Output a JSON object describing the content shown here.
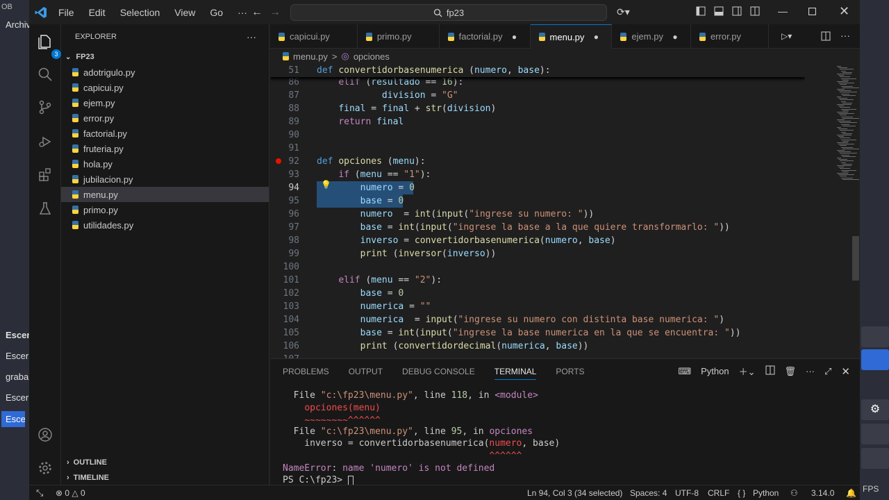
{
  "background_app": {
    "title_fragment": "OB",
    "menu_fragment": "Archiv",
    "left_texts": [
      "Escen",
      "Escer",
      "graba",
      "Escer",
      "Escer"
    ],
    "fps": "FPS"
  },
  "titlebar": {
    "menus": [
      "File",
      "Edit",
      "Selection",
      "View",
      "Go",
      "···"
    ],
    "search_text": "fp23"
  },
  "activity": {
    "badge": "3"
  },
  "explorer": {
    "header": "EXPLORER",
    "more": "···",
    "folder": "FP23",
    "files": [
      "adotrigulo.py",
      "capicui.py",
      "ejem.py",
      "error.py",
      "factorial.py",
      "fruteria.py",
      "hola.py",
      "jubilacion.py",
      "menu.py",
      "primo.py",
      "utilidades.py"
    ],
    "selected": "menu.py",
    "outline": "OUTLINE",
    "timeline": "TIMELINE"
  },
  "tabs": [
    {
      "label": "capicui.py",
      "state": "",
      "active": false
    },
    {
      "label": "primo.py",
      "state": "",
      "active": false
    },
    {
      "label": "factorial.py",
      "state": "●",
      "active": false
    },
    {
      "label": "menu.py",
      "state": "●",
      "active": true
    },
    {
      "label": "ejem.py",
      "state": "●",
      "active": false
    },
    {
      "label": "error.py",
      "state": "",
      "active": false
    }
  ],
  "breadcrumb": {
    "file": "menu.py",
    "separator": ">",
    "symbol": "opciones"
  },
  "editor": {
    "sticky_line": {
      "n": "51",
      "tokens": [
        [
          "kw",
          "def "
        ],
        [
          "fn",
          "convertidorbasenumerica"
        ],
        [
          "op",
          " ("
        ],
        [
          "var",
          "numero"
        ],
        [
          "op",
          ", "
        ],
        [
          "var",
          "base"
        ],
        [
          "op",
          "):"
        ]
      ]
    },
    "lines": [
      {
        "n": "86",
        "tokens": [
          [
            "op",
            "    "
          ],
          [
            "ctl",
            "elif"
          ],
          [
            "op",
            " ("
          ],
          [
            "var",
            "resultado"
          ],
          [
            "op",
            " == "
          ],
          [
            "num",
            "16"
          ],
          [
            "op",
            "):"
          ]
        ]
      },
      {
        "n": "87",
        "tokens": [
          [
            "op",
            "            "
          ],
          [
            "var",
            "division"
          ],
          [
            "op",
            " = "
          ],
          [
            "str",
            "\"G\""
          ]
        ]
      },
      {
        "n": "88",
        "tokens": [
          [
            "op",
            "    "
          ],
          [
            "var",
            "final"
          ],
          [
            "op",
            " = "
          ],
          [
            "var",
            "final"
          ],
          [
            "op",
            " + "
          ],
          [
            "fn",
            "str"
          ],
          [
            "op",
            "("
          ],
          [
            "var",
            "division"
          ],
          [
            "op",
            ")"
          ]
        ]
      },
      {
        "n": "89",
        "tokens": [
          [
            "op",
            "    "
          ],
          [
            "ctl",
            "return"
          ],
          [
            "op",
            " "
          ],
          [
            "var",
            "final"
          ]
        ]
      },
      {
        "n": "90",
        "tokens": []
      },
      {
        "n": "91",
        "tokens": []
      },
      {
        "n": "92",
        "tokens": [
          [
            "kw",
            "def "
          ],
          [
            "fn",
            "opciones"
          ],
          [
            "op",
            " ("
          ],
          [
            "var",
            "menu"
          ],
          [
            "op",
            "):"
          ]
        ]
      },
      {
        "n": "93",
        "tokens": [
          [
            "op",
            "    "
          ],
          [
            "ctl",
            "if"
          ],
          [
            "op",
            " ("
          ],
          [
            "var",
            "menu"
          ],
          [
            "op",
            " == "
          ],
          [
            "str",
            "\"1\""
          ],
          [
            "op",
            "):"
          ]
        ]
      },
      {
        "n": "94",
        "tokens": [
          [
            "op",
            "        "
          ],
          [
            "var",
            "numero"
          ],
          [
            "op",
            " = "
          ],
          [
            "num",
            "0"
          ]
        ]
      },
      {
        "n": "95",
        "tokens": [
          [
            "op",
            "        "
          ],
          [
            "var",
            "base"
          ],
          [
            "op",
            " = "
          ],
          [
            "num",
            "0"
          ]
        ]
      },
      {
        "n": "96",
        "tokens": [
          [
            "op",
            "        "
          ],
          [
            "var",
            "numero"
          ],
          [
            "op",
            "  = "
          ],
          [
            "fn",
            "int"
          ],
          [
            "op",
            "("
          ],
          [
            "fn",
            "input"
          ],
          [
            "op",
            "("
          ],
          [
            "str",
            "\"ingrese su numero: \""
          ],
          [
            "op",
            "))"
          ]
        ]
      },
      {
        "n": "97",
        "tokens": [
          [
            "op",
            "        "
          ],
          [
            "var",
            "base"
          ],
          [
            "op",
            " = "
          ],
          [
            "fn",
            "int"
          ],
          [
            "op",
            "("
          ],
          [
            "fn",
            "input"
          ],
          [
            "op",
            "("
          ],
          [
            "str",
            "\"ingrese la base a la que quiere transformarlo: \""
          ],
          [
            "op",
            "))"
          ]
        ]
      },
      {
        "n": "98",
        "tokens": [
          [
            "op",
            "        "
          ],
          [
            "var",
            "inverso"
          ],
          [
            "op",
            " = "
          ],
          [
            "fn",
            "convertidorbasenumerica"
          ],
          [
            "op",
            "("
          ],
          [
            "var",
            "numero"
          ],
          [
            "op",
            ", "
          ],
          [
            "var",
            "base"
          ],
          [
            "op",
            ")"
          ]
        ]
      },
      {
        "n": "99",
        "tokens": [
          [
            "op",
            "        "
          ],
          [
            "fn",
            "print"
          ],
          [
            "op",
            " ("
          ],
          [
            "fn",
            "inversor"
          ],
          [
            "op",
            "("
          ],
          [
            "var",
            "inverso"
          ],
          [
            "op",
            "))"
          ]
        ]
      },
      {
        "n": "100",
        "tokens": []
      },
      {
        "n": "101",
        "tokens": [
          [
            "op",
            "    "
          ],
          [
            "ctl",
            "elif"
          ],
          [
            "op",
            " ("
          ],
          [
            "var",
            "menu"
          ],
          [
            "op",
            " == "
          ],
          [
            "str",
            "\"2\""
          ],
          [
            "op",
            "):"
          ]
        ]
      },
      {
        "n": "102",
        "tokens": [
          [
            "op",
            "        "
          ],
          [
            "var",
            "base"
          ],
          [
            "op",
            " = "
          ],
          [
            "num",
            "0"
          ]
        ]
      },
      {
        "n": "103",
        "tokens": [
          [
            "op",
            "        "
          ],
          [
            "var",
            "numerica"
          ],
          [
            "op",
            " = "
          ],
          [
            "str",
            "\"\""
          ]
        ]
      },
      {
        "n": "104",
        "tokens": [
          [
            "op",
            "        "
          ],
          [
            "var",
            "numerica"
          ],
          [
            "op",
            "  = "
          ],
          [
            "fn",
            "input"
          ],
          [
            "op",
            "("
          ],
          [
            "str",
            "\"ingrese su numero con distinta base numerica: \""
          ],
          [
            "op",
            ")"
          ]
        ]
      },
      {
        "n": "105",
        "tokens": [
          [
            "op",
            "        "
          ],
          [
            "var",
            "base"
          ],
          [
            "op",
            " = "
          ],
          [
            "fn",
            "int"
          ],
          [
            "op",
            "("
          ],
          [
            "fn",
            "input"
          ],
          [
            "op",
            "("
          ],
          [
            "str",
            "\"ingrese la base numerica en la que se encuentra: \""
          ],
          [
            "op",
            "))"
          ]
        ]
      },
      {
        "n": "106",
        "tokens": [
          [
            "op",
            "        "
          ],
          [
            "fn",
            "print"
          ],
          [
            "op",
            " ("
          ],
          [
            "fn",
            "convertidordecimal"
          ],
          [
            "op",
            "("
          ],
          [
            "var",
            "numerica"
          ],
          [
            "op",
            ", "
          ],
          [
            "var",
            "base"
          ],
          [
            "op",
            "))"
          ]
        ]
      },
      {
        "n": "107",
        "tokens": []
      }
    ],
    "current_line": "94"
  },
  "panel": {
    "tabs": [
      "PROBLEMS",
      "OUTPUT",
      "DEBUG CONSOLE",
      "TERMINAL",
      "PORTS"
    ],
    "active_tab": "TERMINAL",
    "shell": "Python",
    "terminal": [
      [
        [
          "",
          "  File "
        ],
        [
          "tstr",
          "\"c:\\fp23\\menu.py\""
        ],
        [
          "",
          ", line "
        ],
        [
          "tnum",
          "118"
        ],
        [
          "",
          ", in "
        ],
        [
          "tmag",
          "<module>"
        ]
      ],
      [
        [
          "",
          "    "
        ],
        [
          "tred",
          "opciones(menu)"
        ]
      ],
      [
        [
          "tred",
          "    ~~~~~~~~^^^^^^"
        ]
      ],
      [
        [
          "",
          "  File "
        ],
        [
          "tstr",
          "\"c:\\fp23\\menu.py\""
        ],
        [
          "",
          ", line "
        ],
        [
          "tnum",
          "95"
        ],
        [
          "",
          ", in "
        ],
        [
          "tmag",
          "opciones"
        ]
      ],
      [
        [
          "",
          "    inverso = convertidorbasenumerica("
        ],
        [
          "tred",
          "numero"
        ],
        [
          "",
          ", base)"
        ]
      ],
      [
        [
          "tred",
          "                                      ^^^^^^"
        ]
      ],
      [
        [
          "tmag",
          "NameError"
        ],
        [
          "",
          ": "
        ],
        [
          "tmag",
          "name 'numero' is not defined"
        ]
      ],
      [
        [
          "",
          "PS C:\\fp23> "
        ]
      ]
    ]
  },
  "statusbar": {
    "problems_errors": "0",
    "problems_warnings": "0",
    "position": "Ln 94, Col 3 (34 selected)",
    "spaces": "Spaces: 4",
    "encoding": "UTF-8",
    "eol": "CRLF",
    "language": "Python",
    "version": "3.14.0"
  }
}
